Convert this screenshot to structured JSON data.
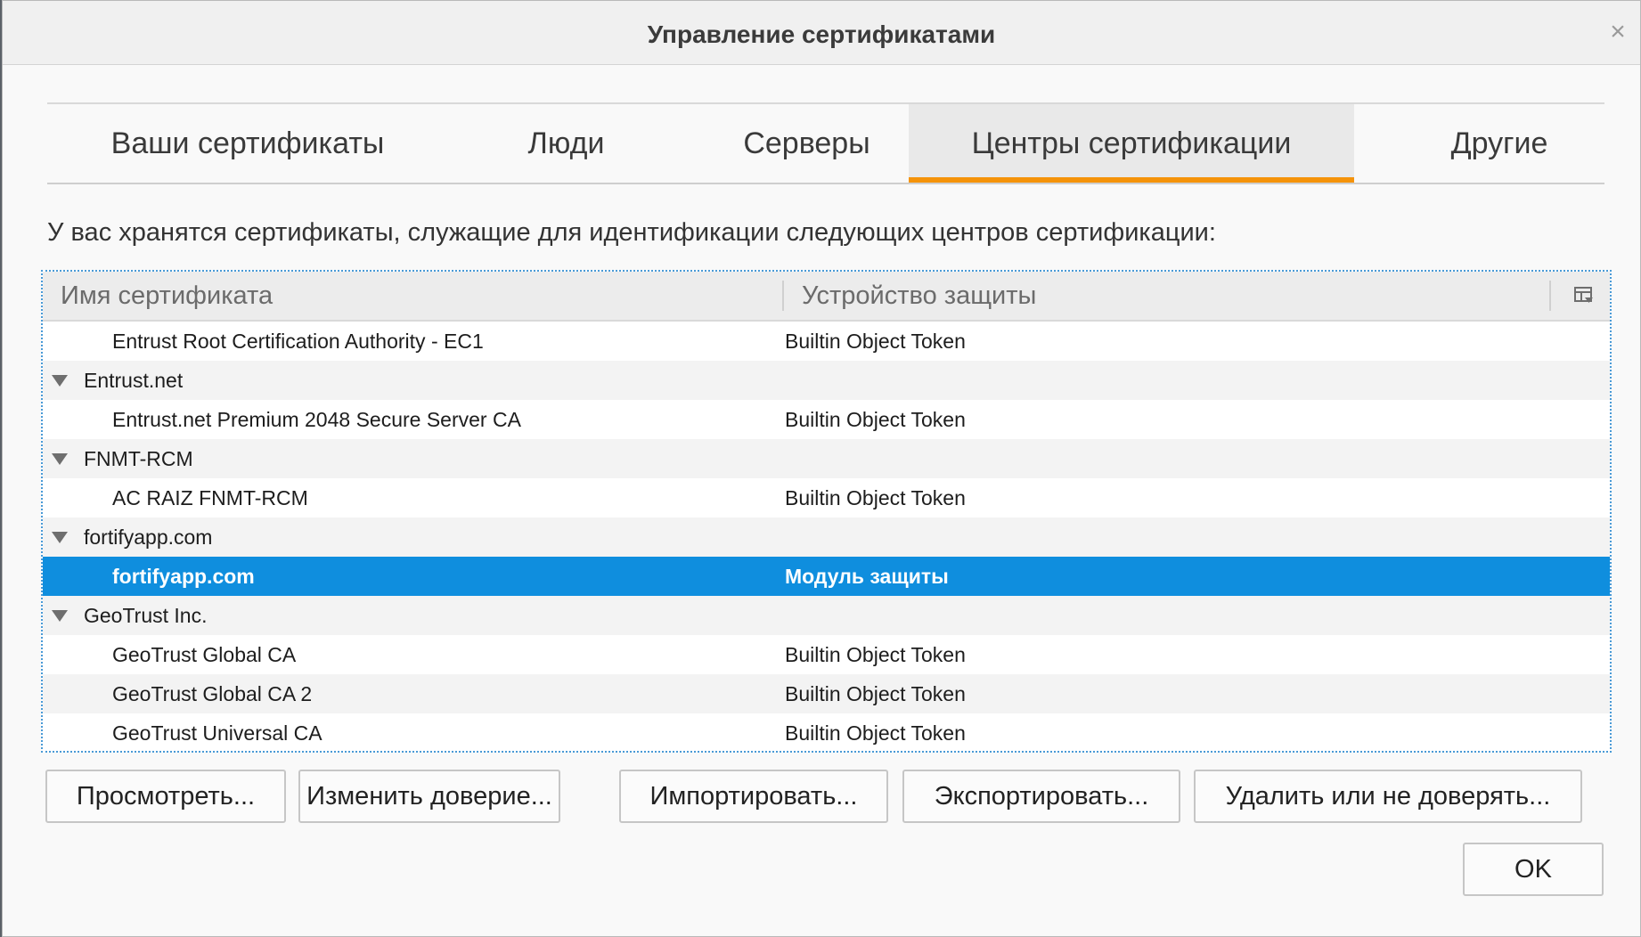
{
  "window": {
    "title": "Управление сертификатами"
  },
  "tabs": [
    {
      "label": "Ваши сертификаты",
      "selected": false
    },
    {
      "label": "Люди",
      "selected": false
    },
    {
      "label": "Серверы",
      "selected": false
    },
    {
      "label": "Центры сертификации",
      "selected": true
    },
    {
      "label": "Другие",
      "selected": false
    }
  ],
  "description": "У вас хранятся сертификаты, служащие для идентификации следующих центров сертификации:",
  "tree": {
    "columns": [
      "Имя сертификата",
      "Устройство защиты"
    ],
    "rows": [
      {
        "type": "item",
        "name": "Entrust Root Certification Authority - EC1",
        "device": "Builtin Object Token"
      },
      {
        "type": "group",
        "name": "Entrust.net",
        "device": ""
      },
      {
        "type": "item",
        "name": "Entrust.net Premium 2048 Secure Server CA",
        "device": "Builtin Object Token"
      },
      {
        "type": "group",
        "name": "FNMT-RCM",
        "device": ""
      },
      {
        "type": "item",
        "name": "AC RAIZ FNMT-RCM",
        "device": "Builtin Object Token"
      },
      {
        "type": "group",
        "name": "fortifyapp.com",
        "device": ""
      },
      {
        "type": "item",
        "name": "fortifyapp.com",
        "device": "Модуль защиты",
        "selected": true
      },
      {
        "type": "group",
        "name": "GeoTrust Inc.",
        "device": ""
      },
      {
        "type": "item",
        "name": "GeoTrust Global CA",
        "device": "Builtin Object Token"
      },
      {
        "type": "item",
        "name": "GeoTrust Global CA 2",
        "device": "Builtin Object Token"
      },
      {
        "type": "item",
        "name": "GeoTrust Universal CA",
        "device": "Builtin Object Token"
      }
    ]
  },
  "buttons": {
    "view": "Просмотреть...",
    "edit_trust": "Изменить доверие...",
    "import": "Импортировать...",
    "export": "Экспортировать...",
    "delete": "Удалить или не доверять...",
    "ok": "OK"
  },
  "icons": {
    "close": "close-icon",
    "column_picker": "column-picker-icon",
    "twisty": "twisty-open-icon"
  },
  "colors": {
    "selection": "#0f8ede",
    "tab_accent": "#f5930a",
    "focus_border": "#4a9ad6"
  }
}
